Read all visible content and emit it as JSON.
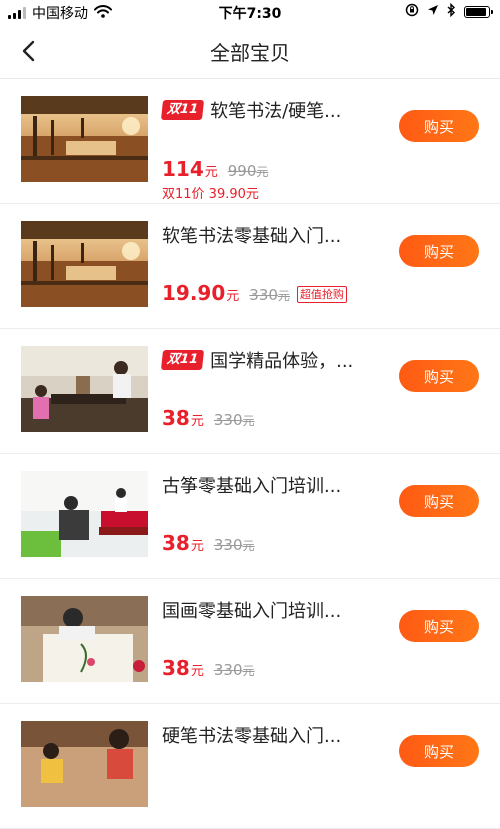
{
  "status_bar": {
    "carrier": "中国移动",
    "time": "下午7:30",
    "signal_bars": 3,
    "battery_level": 0.95,
    "icons": [
      "wifi-icon",
      "lock-rotation-icon",
      "location-icon",
      "bluetooth-icon",
      "battery-icon"
    ]
  },
  "nav": {
    "title": "全部宝贝",
    "back_icon": "chevron-left-icon"
  },
  "colors": {
    "accent": "#e8202c",
    "buy_button": "#ff6a15",
    "strike": "#999999"
  },
  "products": [
    {
      "badge": "双11",
      "title": "软笔书法/硬笔...",
      "price": "114",
      "price_unit": "元",
      "original_price": "990",
      "original_unit": "元",
      "promo_tag": "",
      "sub_price": "双11价 39.90元",
      "buy_label": "购买",
      "image": "calligraphy-room-photo"
    },
    {
      "badge": "",
      "title": "软笔书法零基础入门...",
      "price": "19.90",
      "price_unit": "元",
      "original_price": "330",
      "original_unit": "元",
      "promo_tag": "超值抢购",
      "sub_price": "",
      "buy_label": "购买",
      "image": "calligraphy-room-photo"
    },
    {
      "badge": "双11",
      "title": "国学精品体验，...",
      "price": "38",
      "price_unit": "元",
      "original_price": "330",
      "original_unit": "元",
      "promo_tag": "",
      "sub_price": "",
      "buy_label": "购买",
      "image": "classroom-teaching-photo"
    },
    {
      "badge": "",
      "title": "古筝零基础入门培训...",
      "price": "38",
      "price_unit": "元",
      "original_price": "330",
      "original_unit": "元",
      "promo_tag": "",
      "sub_price": "",
      "buy_label": "购买",
      "image": "guzheng-class-photo"
    },
    {
      "badge": "",
      "title": "国画零基础入门培训...",
      "price": "38",
      "price_unit": "元",
      "original_price": "330",
      "original_unit": "元",
      "promo_tag": "",
      "sub_price": "",
      "buy_label": "购买",
      "image": "chinese-painting-photo"
    },
    {
      "badge": "",
      "title": "硬笔书法零基础入门...",
      "price": "",
      "price_unit": "",
      "original_price": "",
      "original_unit": "",
      "promo_tag": "",
      "sub_price": "",
      "buy_label": "购买",
      "image": "children-class-photo"
    }
  ]
}
